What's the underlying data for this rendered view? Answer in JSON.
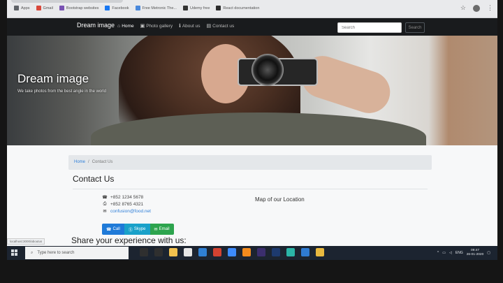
{
  "browser": {
    "bookmarks": [
      {
        "label": "Apps",
        "color": "#5f6368"
      },
      {
        "label": "Gmail",
        "color": "#d9483b"
      },
      {
        "label": "Bootstrap websites",
        "color": "#7952b3"
      },
      {
        "label": "Facebook",
        "color": "#1877f2"
      },
      {
        "label": "Free Metronic The...",
        "color": "#4a89dc"
      },
      {
        "label": "Udemy free",
        "color": "#333"
      },
      {
        "label": "React documentation",
        "color": "#2d2d2d"
      }
    ],
    "status_url": "localhost:3000/aboutus"
  },
  "navbar": {
    "brand": "Dream image",
    "items": [
      {
        "label": "Home",
        "icon": "home-icon",
        "glyph": "⌂",
        "active": true
      },
      {
        "label": "Photo gallery",
        "icon": "camera-icon",
        "glyph": "▣",
        "active": false
      },
      {
        "label": "About us",
        "icon": "info-icon",
        "glyph": "ℹ",
        "active": false
      },
      {
        "label": "Contact us",
        "icon": "address-card-icon",
        "glyph": "▤",
        "active": false
      }
    ],
    "search_placeholder": "Search",
    "search_button": "Search"
  },
  "hero": {
    "title": "Dream image",
    "subtitle": "We take photos from the best angle in the world"
  },
  "breadcrumb": {
    "home": "Home",
    "separator": "/",
    "current": "Contact Us"
  },
  "page": {
    "title": "Contact Us",
    "contact_lines": [
      {
        "icon": "phone-icon",
        "glyph": "☎",
        "text": "+852 1234 5678"
      },
      {
        "icon": "fax-icon",
        "glyph": "⎙",
        "text": "+852 8765 4321"
      },
      {
        "icon": "envelope-icon",
        "glyph": "✉",
        "text": "confusion@food.net"
      }
    ],
    "map_title": "Map of our Location",
    "buttons": {
      "call": "Call",
      "skype": "Skype",
      "email": "Email"
    },
    "share_title": "Share your experience with us:"
  },
  "taskbar": {
    "search_placeholder": "Type here to search",
    "pinned": [
      {
        "name": "cortana-icon",
        "color": "#2f2f2f"
      },
      {
        "name": "task-view-icon",
        "color": "#2f2f2f"
      },
      {
        "name": "file-explorer-icon",
        "color": "#f2c14e"
      },
      {
        "name": "store-icon",
        "color": "#e6e6e6"
      },
      {
        "name": "mail-icon",
        "color": "#2f80d4"
      },
      {
        "name": "app-red-icon",
        "color": "#d24231"
      },
      {
        "name": "dropbox-icon",
        "color": "#3d8bfd"
      },
      {
        "name": "app-orange-icon",
        "color": "#f28a1d"
      },
      {
        "name": "premiere-icon",
        "color": "#3b2e6e"
      },
      {
        "name": "photoshop-icon",
        "color": "#1d3a6e"
      },
      {
        "name": "edge-icon",
        "color": "#2bb5a8"
      },
      {
        "name": "vscode-icon",
        "color": "#2f7bd2"
      },
      {
        "name": "chrome-icon",
        "color": "#e9b93f"
      }
    ],
    "language": "ENG",
    "time": "09:47",
    "date": "26-01-2020"
  }
}
